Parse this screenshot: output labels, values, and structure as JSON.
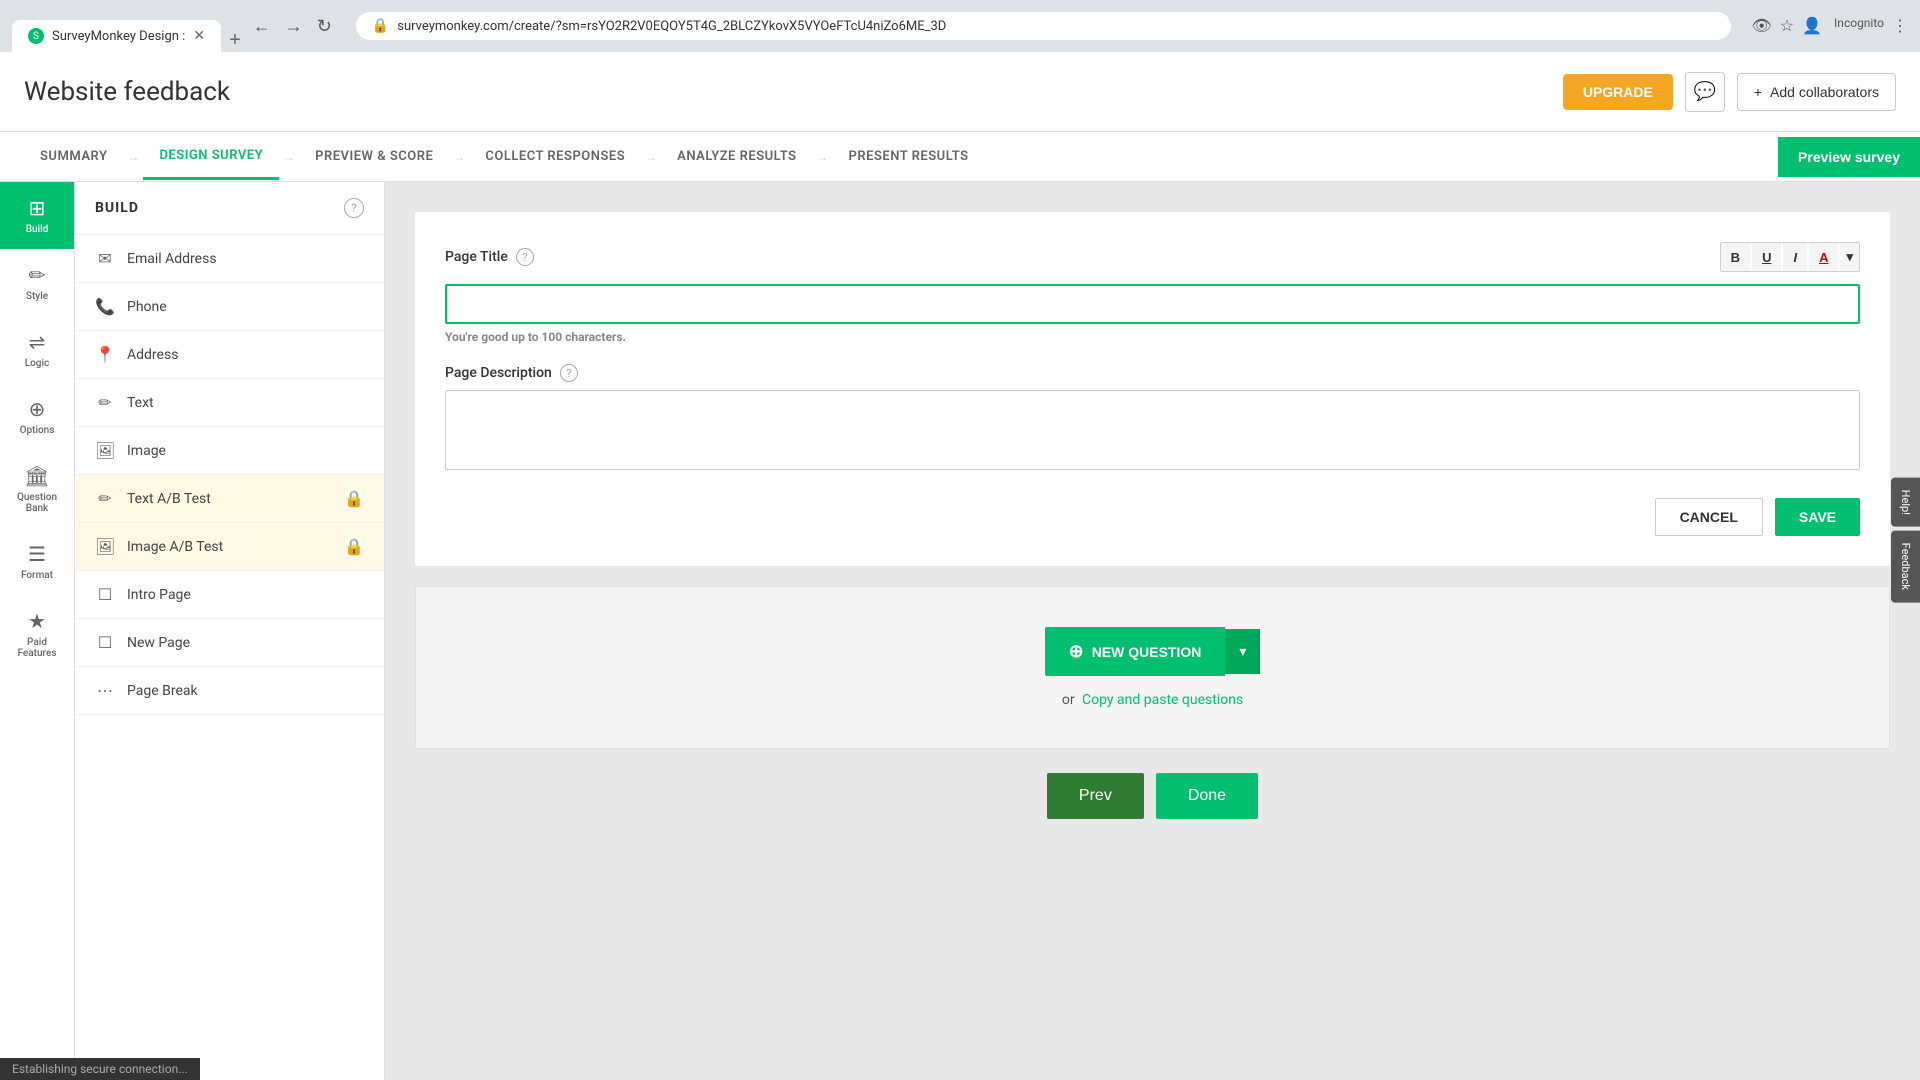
{
  "browser": {
    "url": "surveymonkey.com/create/?sm=rsYO2R2V0EQOY5T4G_2BLCZYkovX5VYOeFTcU4niZo6ME_3D",
    "tab_title": "SurveyMonkey Design :",
    "favicon": "SM"
  },
  "header": {
    "title": "Website feedback",
    "upgrade_label": "UPGRADE",
    "collaborators_label": "Add collaborators"
  },
  "nav": {
    "tabs": [
      {
        "id": "summary",
        "label": "SUMMARY",
        "active": false
      },
      {
        "id": "design",
        "label": "DESIGN SURVEY",
        "active": true
      },
      {
        "id": "preview",
        "label": "PREVIEW & SCORE",
        "active": false
      },
      {
        "id": "collect",
        "label": "COLLECT RESPONSES",
        "active": false
      },
      {
        "id": "analyze",
        "label": "ANALYZE RESULTS",
        "active": false
      },
      {
        "id": "present",
        "label": "PRESENT RESULTS",
        "active": false
      }
    ],
    "preview_survey_label": "Preview survey"
  },
  "sidebar": {
    "items": [
      {
        "id": "build",
        "label": "Build",
        "icon": "⊞",
        "active": true
      },
      {
        "id": "style",
        "label": "Style",
        "icon": "✏",
        "active": false
      },
      {
        "id": "logic",
        "label": "Logic",
        "icon": "⇌",
        "active": false
      },
      {
        "id": "options",
        "label": "Options",
        "icon": "⊕",
        "active": false
      },
      {
        "id": "question-bank",
        "label": "Question Bank",
        "icon": "🏦",
        "active": false
      },
      {
        "id": "format",
        "label": "Format",
        "icon": "☰",
        "active": false
      },
      {
        "id": "paid-features",
        "label": "Paid Features",
        "icon": "★",
        "active": false
      }
    ]
  },
  "build_panel": {
    "title": "BUILD",
    "items": [
      {
        "id": "email",
        "icon": "✉",
        "label": "Email Address",
        "locked": false
      },
      {
        "id": "phone",
        "icon": "📞",
        "label": "Phone",
        "locked": false
      },
      {
        "id": "address",
        "icon": "📍",
        "label": "Address",
        "locked": false
      },
      {
        "id": "text",
        "icon": "✏",
        "label": "Text",
        "locked": false
      },
      {
        "id": "image",
        "icon": "🖼",
        "label": "Image",
        "locked": false
      },
      {
        "id": "text-ab",
        "icon": "✏",
        "label": "Text A/B Test",
        "locked": true
      },
      {
        "id": "image-ab",
        "icon": "🖼",
        "label": "Image A/B Test",
        "locked": true
      },
      {
        "id": "intro",
        "icon": "☐",
        "label": "Intro Page",
        "locked": false
      },
      {
        "id": "new-page",
        "icon": "☐",
        "label": "New Page",
        "locked": false
      },
      {
        "id": "page-break",
        "icon": "⋯",
        "label": "Page Break",
        "locked": false
      }
    ]
  },
  "page_editor": {
    "page_title_label": "Page Title",
    "page_title_placeholder": "",
    "char_hint": "You're good up to ",
    "char_limit": "100",
    "char_hint_suffix": " characters.",
    "page_desc_label": "Page Description",
    "cancel_label": "CANCEL",
    "save_label": "SAVE",
    "formatting": {
      "bold": "B",
      "underline": "U",
      "italic": "I",
      "color": "A"
    }
  },
  "question_area": {
    "new_question_label": "NEW QUESTION",
    "or_text": "or",
    "copy_paste_label": "Copy and paste questions"
  },
  "navigation": {
    "prev_label": "Prev",
    "done_label": "Done"
  },
  "status_bar": {
    "text": "Establishing secure connection..."
  },
  "right_helpers": [
    {
      "id": "help",
      "label": "Help!"
    },
    {
      "id": "feedback",
      "label": "Feedback"
    }
  ]
}
